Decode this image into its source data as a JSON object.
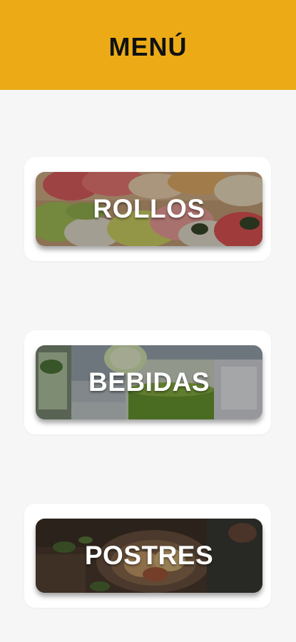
{
  "header": {
    "title": "MENÚ",
    "color": "#ecab16"
  },
  "menu": {
    "items": [
      {
        "label": "ROLLOS"
      },
      {
        "label": "BEBIDAS"
      },
      {
        "label": "POSTRES"
      }
    ]
  }
}
